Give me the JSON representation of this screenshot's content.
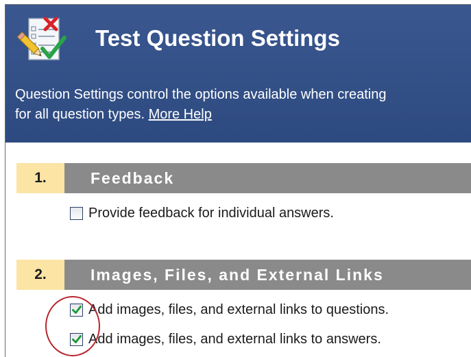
{
  "header": {
    "title": "Test Question Settings",
    "description_line1": "Question Settings control the options available when creating",
    "description_line2_prefix": "for all question types. ",
    "help_link": "More Help",
    "icon": "checklist-icon"
  },
  "sections": [
    {
      "number": "1.",
      "title": "Feedback",
      "options": [
        {
          "label": "Provide feedback for individual answers.",
          "checked": false
        }
      ]
    },
    {
      "number": "2.",
      "title": "Images, Files, and External Links",
      "options": [
        {
          "label": "Add images, files, and external links to questions.",
          "checked": true
        },
        {
          "label": "Add images, files, and external links to answers.",
          "checked": true
        }
      ]
    }
  ],
  "colors": {
    "header_bg": "#2e4a7f",
    "section_bar": "#8a8a8a",
    "number_bg": "#fbe4a4",
    "checkmark": "#1f9a3a",
    "annotation": "#b9252c"
  }
}
